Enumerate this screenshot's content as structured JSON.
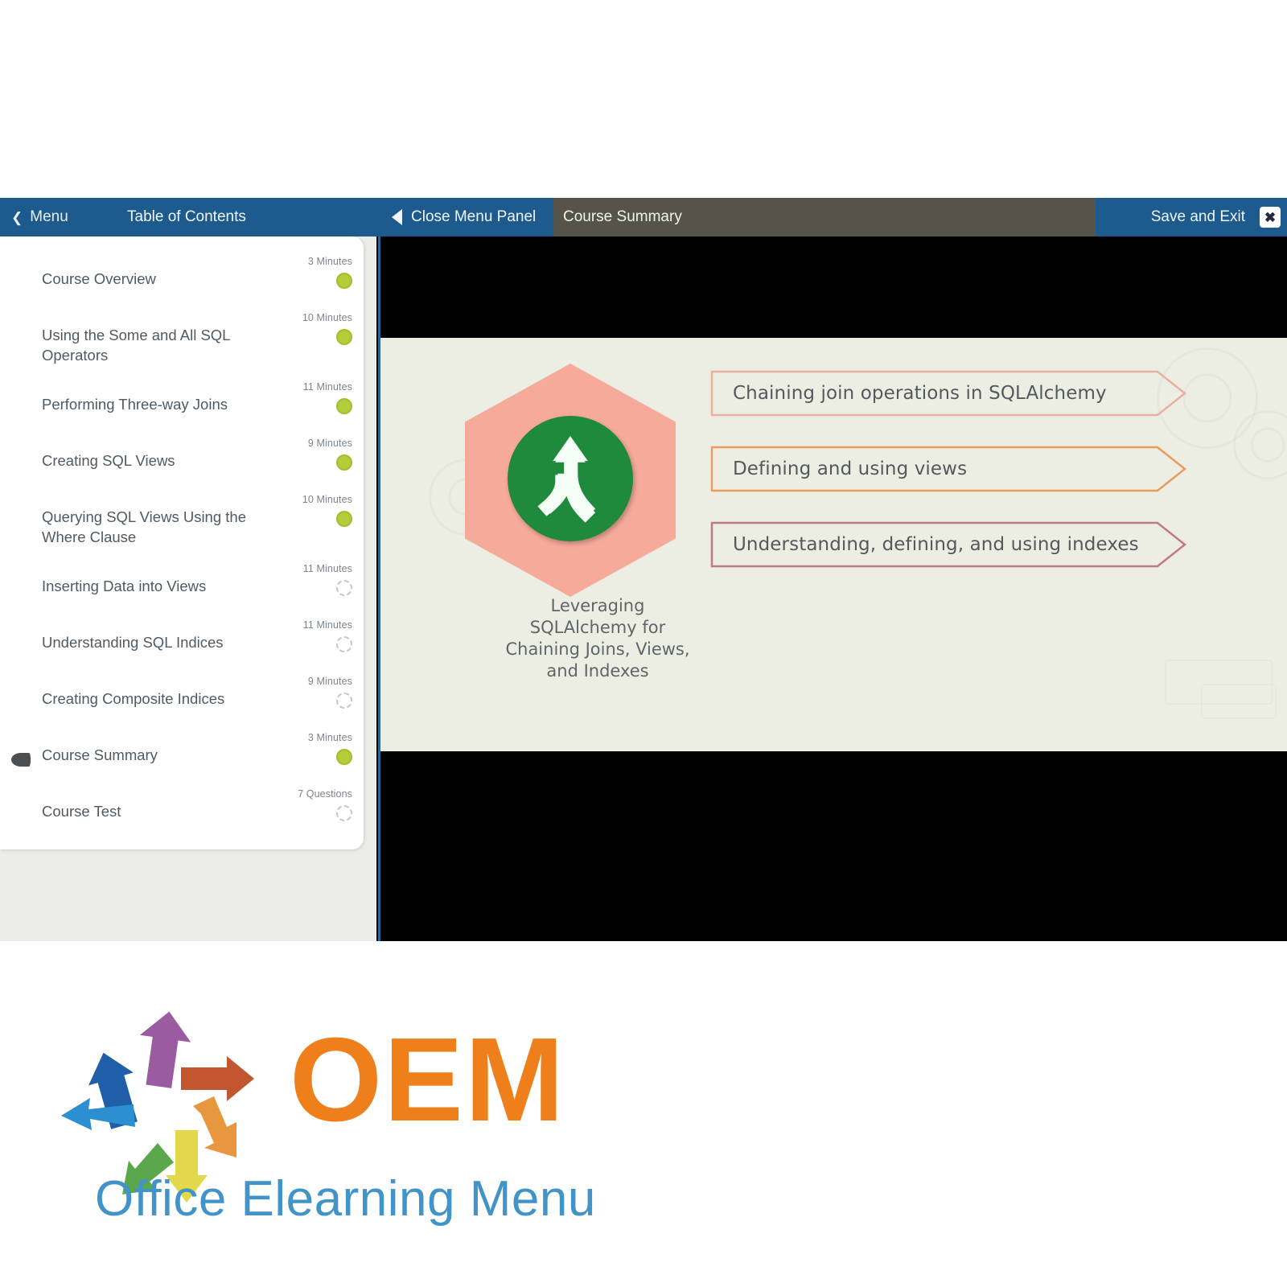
{
  "header": {
    "menu_label": "Menu",
    "menu_chevron_icon": "chevron-left-icon",
    "toc_title": "Table of Contents",
    "close_menu_label": "Close Menu Panel",
    "close_menu_icon": "triangle-left-icon",
    "lesson_title": "Course Summary",
    "save_exit_label": "Save and Exit",
    "close_icon": "close-x-icon",
    "blue": "#1d5b8e",
    "brown": "#56544a"
  },
  "toc": {
    "items": [
      {
        "label": "Course Overview",
        "meta": "3 Minutes",
        "status": "done",
        "current": false
      },
      {
        "label": "Using the Some and All SQL Operators",
        "meta": "10 Minutes",
        "status": "done",
        "current": false
      },
      {
        "label": "Performing Three-way Joins",
        "meta": "11 Minutes",
        "status": "done",
        "current": false
      },
      {
        "label": "Creating SQL Views",
        "meta": "9 Minutes",
        "status": "done",
        "current": false
      },
      {
        "label": "Querying SQL Views Using the Where Clause",
        "meta": "10 Minutes",
        "status": "done",
        "current": false
      },
      {
        "label": "Inserting Data into Views",
        "meta": "11 Minutes",
        "status": "todo",
        "current": false
      },
      {
        "label": "Understanding SQL Indices",
        "meta": "11 Minutes",
        "status": "todo",
        "current": false
      },
      {
        "label": "Creating Composite Indices",
        "meta": "9 Minutes",
        "status": "todo",
        "current": false
      },
      {
        "label": "Course Summary",
        "meta": "3 Minutes",
        "status": "done",
        "current": true
      },
      {
        "label": "Course Test",
        "meta": "7 Questions",
        "status": "todo",
        "current": false
      }
    ],
    "done_color": "#b3ce3a",
    "todo_color": "#c3c7c9"
  },
  "slide": {
    "hex_icon": "merging-arrows-icon",
    "hex_fill": "#f6aa9a",
    "circle_fill": "#1f8a3c",
    "caption": "Leveraging SQLAlchemy for Chaining Joins, Views, and Indexes",
    "background": "#eceee3",
    "callouts": [
      {
        "text": "Chaining join operations in SQLAlchemy",
        "color": "#e8b09f"
      },
      {
        "text": "Defining and using views",
        "color": "#e99c5e"
      },
      {
        "text": "Understanding, defining, and using indexes",
        "color": "#c0788a"
      }
    ]
  },
  "logo": {
    "wordmark": "OEM",
    "tagline": "Office Elearning Menu",
    "orange": "#ef7f1a",
    "blue": "#4193c8",
    "arrows_icon": "pinwheel-arrows-icon",
    "arrow_colors": [
      "#1f5fa8",
      "#9b5ba0",
      "#c1562f",
      "#2b8fd1",
      "#e8973f",
      "#5aa84b",
      "#e2d84a"
    ]
  }
}
